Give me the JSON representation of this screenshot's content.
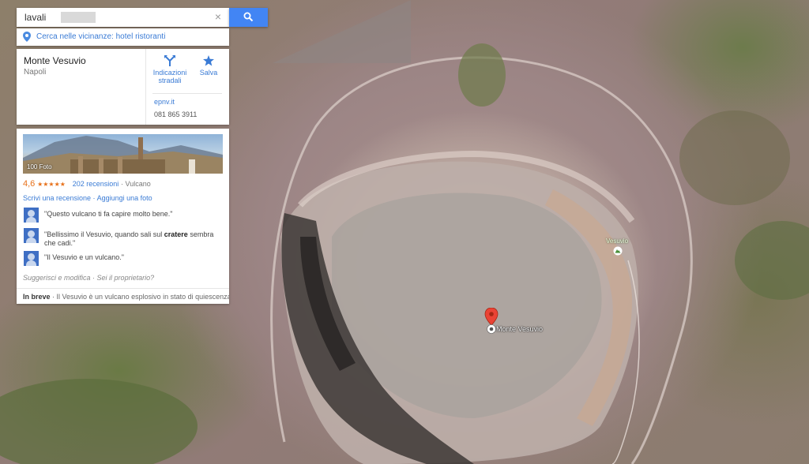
{
  "search": {
    "query": "lavali",
    "clear_label": "×"
  },
  "nearby": {
    "label": "Cerca nelle vicinanze: hotel ristoranti"
  },
  "place": {
    "name": "Monte Vesuvio",
    "city": "Napoli",
    "directions_label": "Indicazioni stradali",
    "save_label": "Salva",
    "website": "epnv.it",
    "phone": "081 865 3911"
  },
  "reviews": {
    "photo_count": "100 Foto",
    "rating": "4,6",
    "stars": "★★★★★",
    "rating_value": 4.6,
    "reviews_count": "202 recensioni",
    "category": "· Vulcano",
    "write_review": "Scrivi una recensione",
    "links_sep": " · ",
    "add_photo": "Aggiungi una foto",
    "quotes": [
      {
        "text": "\"Questo vulcano ti fa capire molto bene.\""
      },
      {
        "text_before": "\"Bellissimo il Vesuvio, quando sali sul ",
        "bold": "cratere",
        "text_after": " sembra che cadi.\""
      },
      {
        "text": "\"Il Vesuvio e un vulcano.\""
      }
    ],
    "suggest": "Suggerisci e modifica",
    "suggest_sep": " · ",
    "owner": "Sei il proprietario?",
    "brief_label": "In breve",
    "brief_text": " · Il Vesuvio è un vulcano esplosivo in stato di quiescenza d..."
  },
  "map": {
    "marker_label": "Monte Vesuvio",
    "poi_label": "Vesuvio",
    "marker_color": "#ea4335",
    "accent_color": "#4285f4",
    "link_color": "#3a7bd5",
    "star_color": "#e7711b"
  }
}
